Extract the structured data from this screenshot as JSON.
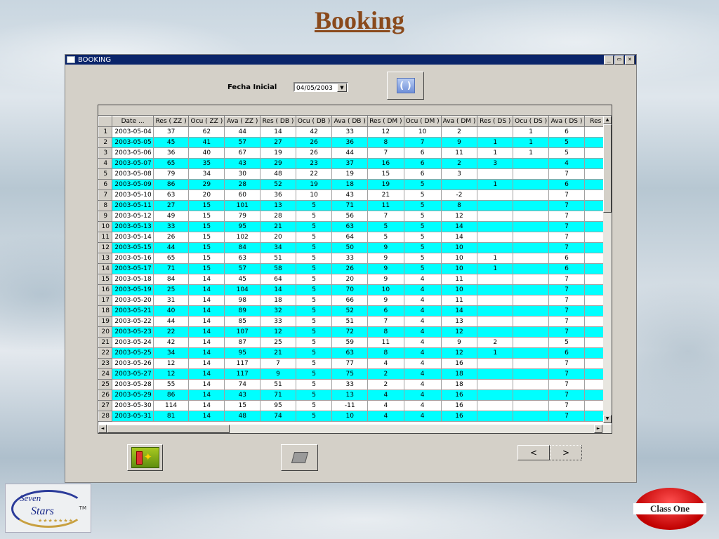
{
  "page": {
    "title": "Booking"
  },
  "window": {
    "title": "BOOKING",
    "controls": [
      "_",
      "▭",
      "×"
    ]
  },
  "filter": {
    "label": "Fecha Inicial",
    "date_value": "04/05/2003"
  },
  "grid": {
    "columns": [
      "",
      "Date ...",
      "Res ( ZZ )",
      "Ocu ( ZZ )",
      "Ava ( ZZ )",
      "Res ( DB )",
      "Ocu ( DB )",
      "Ava ( DB )",
      "Res ( DM )",
      "Ocu ( DM )",
      "Ava ( DM )",
      "Res ( DS )",
      "Ocu ( DS )",
      "Ava ( DS )",
      "Res ("
    ],
    "rows": [
      [
        "1",
        "2003-05-04",
        "37",
        "62",
        "44",
        "14",
        "42",
        "33",
        "12",
        "10",
        "2",
        "",
        "1",
        "6",
        ""
      ],
      [
        "2",
        "2003-05-05",
        "45",
        "41",
        "57",
        "27",
        "26",
        "36",
        "8",
        "7",
        "9",
        "1",
        "1",
        "5",
        ""
      ],
      [
        "3",
        "2003-05-06",
        "36",
        "40",
        "67",
        "19",
        "26",
        "44",
        "7",
        "6",
        "11",
        "1",
        "1",
        "5",
        ""
      ],
      [
        "4",
        "2003-05-07",
        "65",
        "35",
        "43",
        "29",
        "23",
        "37",
        "16",
        "6",
        "2",
        "3",
        "",
        "4",
        ""
      ],
      [
        "5",
        "2003-05-08",
        "79",
        "34",
        "30",
        "48",
        "22",
        "19",
        "15",
        "6",
        "3",
        "",
        "",
        "7",
        ""
      ],
      [
        "6",
        "2003-05-09",
        "86",
        "29",
        "28",
        "52",
        "19",
        "18",
        "19",
        "5",
        "",
        "1",
        "",
        "6",
        ""
      ],
      [
        "7",
        "2003-05-10",
        "63",
        "20",
        "60",
        "36",
        "10",
        "43",
        "21",
        "5",
        "-2",
        "",
        "",
        "7",
        ""
      ],
      [
        "8",
        "2003-05-11",
        "27",
        "15",
        "101",
        "13",
        "5",
        "71",
        "11",
        "5",
        "8",
        "",
        "",
        "7",
        ""
      ],
      [
        "9",
        "2003-05-12",
        "49",
        "15",
        "79",
        "28",
        "5",
        "56",
        "7",
        "5",
        "12",
        "",
        "",
        "7",
        ""
      ],
      [
        "10",
        "2003-05-13",
        "33",
        "15",
        "95",
        "21",
        "5",
        "63",
        "5",
        "5",
        "14",
        "",
        "",
        "7",
        ""
      ],
      [
        "11",
        "2003-05-14",
        "26",
        "15",
        "102",
        "20",
        "5",
        "64",
        "5",
        "5",
        "14",
        "",
        "",
        "7",
        ""
      ],
      [
        "12",
        "2003-05-15",
        "44",
        "15",
        "84",
        "34",
        "5",
        "50",
        "9",
        "5",
        "10",
        "",
        "",
        "7",
        ""
      ],
      [
        "13",
        "2003-05-16",
        "65",
        "15",
        "63",
        "51",
        "5",
        "33",
        "9",
        "5",
        "10",
        "1",
        "",
        "6",
        ""
      ],
      [
        "14",
        "2003-05-17",
        "71",
        "15",
        "57",
        "58",
        "5",
        "26",
        "9",
        "5",
        "10",
        "1",
        "",
        "6",
        ""
      ],
      [
        "15",
        "2003-05-18",
        "84",
        "14",
        "45",
        "64",
        "5",
        "20",
        "9",
        "4",
        "11",
        "",
        "",
        "7",
        ""
      ],
      [
        "16",
        "2003-05-19",
        "25",
        "14",
        "104",
        "14",
        "5",
        "70",
        "10",
        "4",
        "10",
        "",
        "",
        "7",
        ""
      ],
      [
        "17",
        "2003-05-20",
        "31",
        "14",
        "98",
        "18",
        "5",
        "66",
        "9",
        "4",
        "11",
        "",
        "",
        "7",
        ""
      ],
      [
        "18",
        "2003-05-21",
        "40",
        "14",
        "89",
        "32",
        "5",
        "52",
        "6",
        "4",
        "14",
        "",
        "",
        "7",
        ""
      ],
      [
        "19",
        "2003-05-22",
        "44",
        "14",
        "85",
        "33",
        "5",
        "51",
        "7",
        "4",
        "13",
        "",
        "",
        "7",
        ""
      ],
      [
        "20",
        "2003-05-23",
        "22",
        "14",
        "107",
        "12",
        "5",
        "72",
        "8",
        "4",
        "12",
        "",
        "",
        "7",
        ""
      ],
      [
        "21",
        "2003-05-24",
        "42",
        "14",
        "87",
        "25",
        "5",
        "59",
        "11",
        "4",
        "9",
        "2",
        "",
        "5",
        ""
      ],
      [
        "22",
        "2003-05-25",
        "34",
        "14",
        "95",
        "21",
        "5",
        "63",
        "8",
        "4",
        "12",
        "1",
        "",
        "6",
        ""
      ],
      [
        "23",
        "2003-05-26",
        "12",
        "14",
        "117",
        "7",
        "5",
        "77",
        "4",
        "4",
        "16",
        "",
        "",
        "7",
        ""
      ],
      [
        "24",
        "2003-05-27",
        "12",
        "14",
        "117",
        "9",
        "5",
        "75",
        "2",
        "4",
        "18",
        "",
        "",
        "7",
        ""
      ],
      [
        "25",
        "2003-05-28",
        "55",
        "14",
        "74",
        "51",
        "5",
        "33",
        "2",
        "4",
        "18",
        "",
        "",
        "7",
        ""
      ],
      [
        "26",
        "2003-05-29",
        "86",
        "14",
        "43",
        "71",
        "5",
        "13",
        "4",
        "4",
        "16",
        "",
        "",
        "7",
        ""
      ],
      [
        "27",
        "2003-05-30",
        "114",
        "14",
        "15",
        "95",
        "5",
        "-11",
        "4",
        "4",
        "16",
        "",
        "",
        "7",
        ""
      ],
      [
        "28",
        "2003-05-31",
        "81",
        "14",
        "48",
        "74",
        "5",
        "10",
        "4",
        "4",
        "16",
        "",
        "",
        "7",
        ""
      ]
    ],
    "highlight_color": "#00ffff"
  },
  "buttons": {
    "prev_label": "<",
    "next_label": ">",
    "refresh_icon": "refresh-icon",
    "exit_icon": "exit-icon",
    "print_icon": "printer-icon"
  },
  "scrollbars": {
    "up": "▲",
    "down": "▼",
    "left": "◄",
    "right": "►"
  },
  "logos": {
    "left_word1": "Seven",
    "left_word2": "Stars",
    "left_tm": "TM",
    "left_stars": "★★★★★★★",
    "right_text": "Class One"
  }
}
